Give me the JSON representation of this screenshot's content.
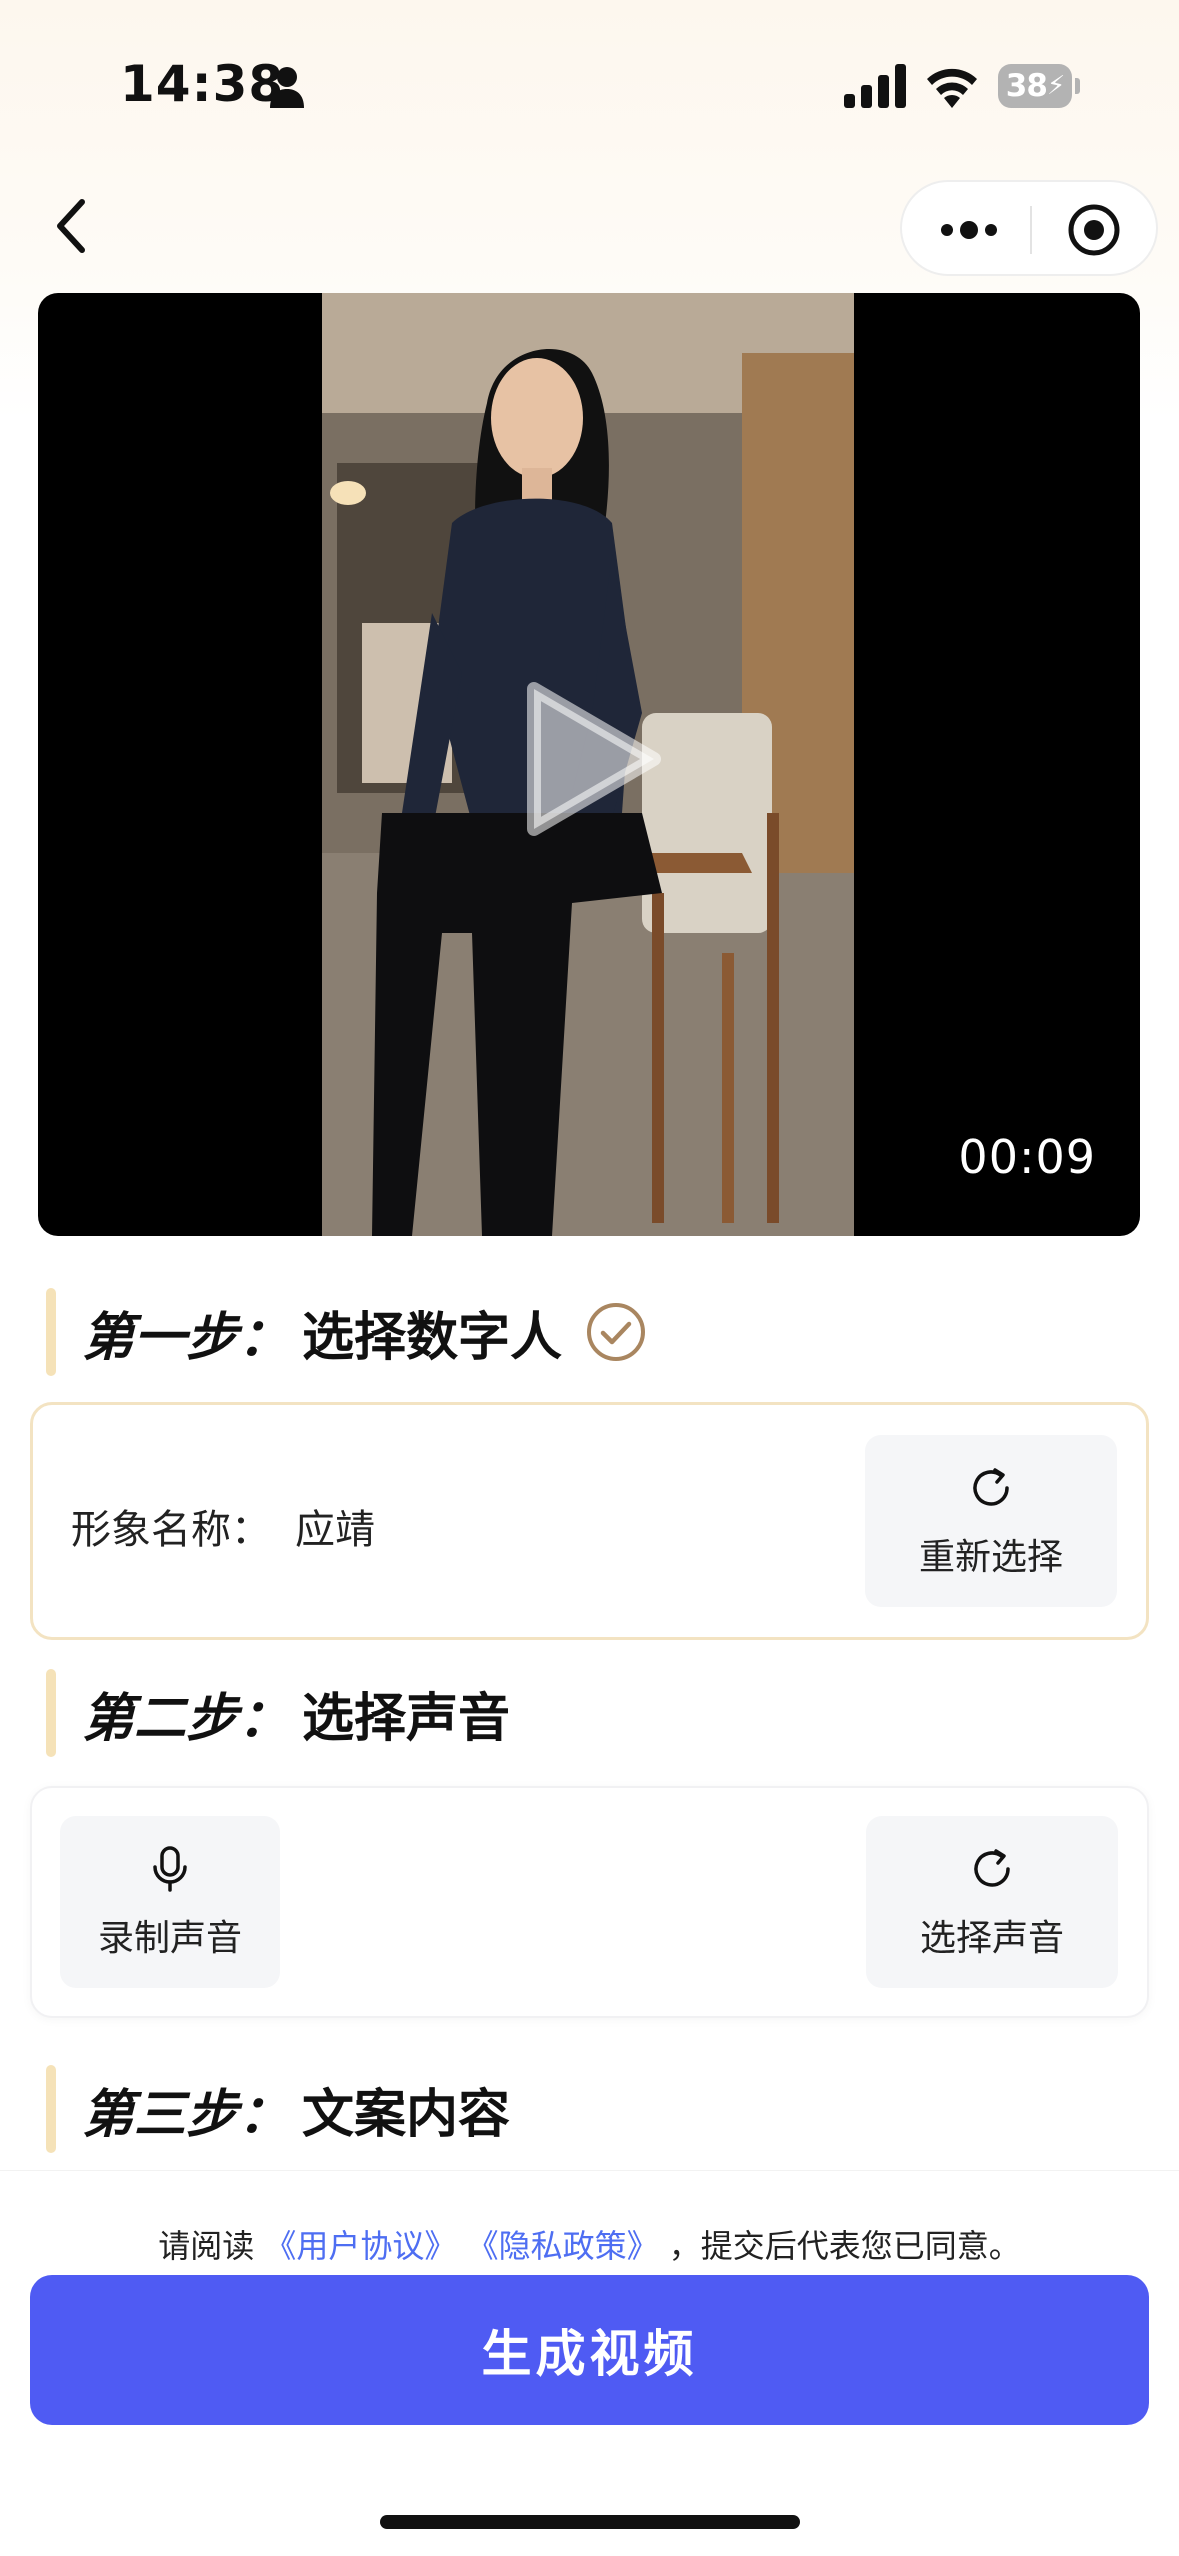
{
  "status_bar": {
    "time": "14:38",
    "battery_level": "38",
    "icons": [
      "person-icon",
      "signal-icon",
      "wifi-icon",
      "battery-charging-icon"
    ]
  },
  "nav": {
    "icons": [
      "back-icon",
      "more-icon",
      "target-icon"
    ]
  },
  "video": {
    "duration": "00:09",
    "icon": "play-icon"
  },
  "step1": {
    "label": "第一步：",
    "title": "选择数字人",
    "name_label": "形象名称：",
    "name_value": "应靖",
    "reselect_label": "重新选择"
  },
  "step2": {
    "label": "第二步：",
    "title": "选择声音",
    "record_label": "录制声音",
    "select_label": "选择声音"
  },
  "step3": {
    "label": "第三步：",
    "title": "文案内容"
  },
  "agreement": {
    "prefix": "请阅读",
    "user_agreement": "《用户协议》",
    "privacy_policy": "《隐私政策》",
    "suffix": "，提交后代表您已同意。"
  },
  "submit_label": "生成视频",
  "colors": {
    "accent": "#4f5bf3",
    "link": "#4e6ef2",
    "step_bar": "#f5e2b8",
    "check": "#a98660"
  }
}
